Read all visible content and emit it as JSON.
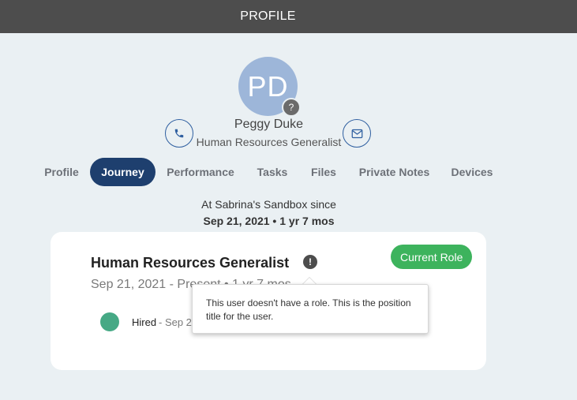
{
  "header": {
    "title": "PROFILE"
  },
  "profile": {
    "initials": "PD",
    "avatar_badge": "?",
    "name": "Peggy Duke",
    "title": "Human Resources Generalist",
    "avatar_color": "#9db6d9"
  },
  "tabs": [
    {
      "label": "Profile"
    },
    {
      "label": "Journey"
    },
    {
      "label": "Performance"
    },
    {
      "label": "Tasks"
    },
    {
      "label": "Files"
    },
    {
      "label": "Private Notes"
    },
    {
      "label": "Devices"
    }
  ],
  "active_tab": "Journey",
  "since": {
    "label": "At Sabrina's Sandbox since",
    "date": "Sep 21, 2021 • 1 yr 7 mos"
  },
  "role_card": {
    "title": "Human Resources Generalist",
    "info_icon": "!",
    "badge": "Current Role",
    "dates": "Sep 21, 2021 - Present • 1 yr 7 mos",
    "event": {
      "label": "Hired",
      "date": "- Sep 21, 2021"
    }
  },
  "tooltip": {
    "text": "This user doesn't have a role. This is the position title for the user."
  },
  "colors": {
    "header_bg": "#4d4d4d",
    "active_tab_bg": "#1e3f6e",
    "badge_green": "#3db35d",
    "event_dot": "#46a985",
    "icon_blue": "#2f5fa0"
  }
}
